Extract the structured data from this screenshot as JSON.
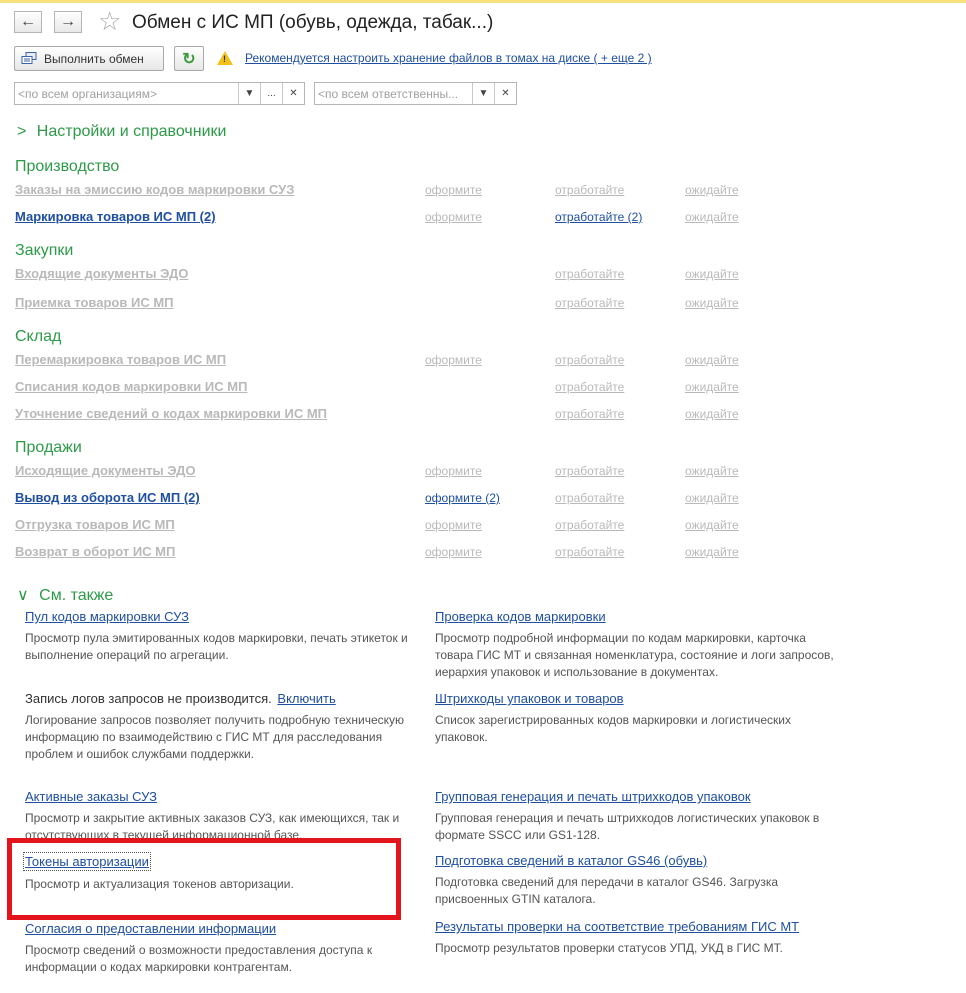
{
  "window": {
    "title": "Обмен с ИС МП (обувь, одежда, табак...)"
  },
  "toolbar": {
    "exchange_label": "Выполнить обмен",
    "warning_link": "Рекомендуется настроить хранение файлов в томах на диске ( + еще 2 )"
  },
  "filters": {
    "org_placeholder": "<по всем организациям>",
    "resp_placeholder": "<по всем ответственны..."
  },
  "settings_section": {
    "label": "Настройки и справочники"
  },
  "groups": [
    {
      "title": "Производство",
      "items": [
        {
          "label": "Заказы на эмиссию кодов маркировки СУЗ",
          "s1": "оформите",
          "s2": "отработайте",
          "s3": "ожидайте"
        },
        {
          "label": "Маркировка товаров ИС МП (2)",
          "s1": "оформите",
          "s2": "отработайте (2)",
          "s3": "ожидайте"
        }
      ]
    },
    {
      "title": "Закупки",
      "items": [
        {
          "label": "Входящие документы ЭДО",
          "s2": "отработайте",
          "s3": "ожидайте"
        },
        {
          "label": "Приемка товаров ИС МП",
          "s2": "отработайте",
          "s3": "ожидайте"
        }
      ]
    },
    {
      "title": "Склад",
      "items": [
        {
          "label": "Перемаркировка товаров ИС МП",
          "s1": "оформите",
          "s2": "отработайте",
          "s3": "ожидайте"
        },
        {
          "label": "Списания кодов маркировки ИС МП",
          "s2": "отработайте",
          "s3": "ожидайте"
        },
        {
          "label": "Уточнение сведений о кодах маркировки ИС МП",
          "s2": "отработайте",
          "s3": "ожидайте"
        }
      ]
    },
    {
      "title": "Продажи",
      "items": [
        {
          "label": "Исходящие документы ЭДО",
          "s1": "оформите",
          "s2": "отработайте",
          "s3": "ожидайте"
        },
        {
          "label": "Вывод из оборота ИС МП (2)",
          "s1": "оформите (2)",
          "s2": "отработайте",
          "s3": "ожидайте"
        },
        {
          "label": "Отгрузка товаров ИС МП",
          "s1": "оформите",
          "s2": "отработайте",
          "s3": "ожидайте"
        },
        {
          "label": "Возврат в оборот ИС МП",
          "s1": "оформите",
          "s2": "отработайте",
          "s3": "ожидайте"
        }
      ]
    }
  ],
  "see_also": {
    "label": "См. также",
    "left": [
      {
        "title": "Пул кодов маркировки СУЗ",
        "desc": "Просмотр пула эмитированных кодов маркировки, печать этикеток и выполнение операций по агрегации."
      },
      {
        "text": "Запись логов запросов не производится.",
        "link": "Включить",
        "desc": "Логирование запросов позволяет получить подробную техническую информацию по взаимодействию с ГИС МТ для расследования проблем и ошибок службами поддержки."
      },
      {
        "title": "Активные заказы СУЗ",
        "desc": "Просмотр и закрытие активных заказов СУЗ, как имеющихся, так и отсутствующих в текущей информационной базе."
      },
      {
        "title": "Токены авторизации",
        "desc": "Просмотр и актуализация токенов авторизации."
      },
      {
        "title": "Согласия о предоставлении информации",
        "desc": "Просмотр сведений о возможности предоставления доступа к информации о кодах маркировки контрагентам."
      }
    ],
    "right": [
      {
        "title": "Проверка кодов маркировки",
        "desc": "Просмотр подробной информации по кодам маркировки, карточка товара ГИС МТ и связанная номенклатура, состояние и логи запросов, иерархия упаковок и использование в документах."
      },
      {
        "title": "Штрихкоды упаковок и товаров",
        "desc": "Список зарегистрированных кодов маркировки и логистических упаковок."
      },
      {
        "title": "Групповая генерация и печать штрихкодов упаковок",
        "desc": "Групповая генерация и печать штрихкодов логистических упаковок в формате SSCC или GS1-128."
      },
      {
        "title": "Подготовка сведений в каталог GS46 (обувь)",
        "desc": "Подготовка сведений для передачи в каталог GS46. Загрузка присвоенных GTIN каталога."
      },
      {
        "title": "Результаты проверки на соответствие требованиям ГИС МТ",
        "desc": "Просмотр результатов проверки статусов УПД, УКД в ГИС МТ."
      }
    ]
  },
  "colors": {
    "group_heading": "#2d9a48",
    "link_active": "#1f4fa0",
    "link_inactive": "#b9b9b9",
    "highlight_box": "#e3141b",
    "warning": "#f2c21b"
  }
}
